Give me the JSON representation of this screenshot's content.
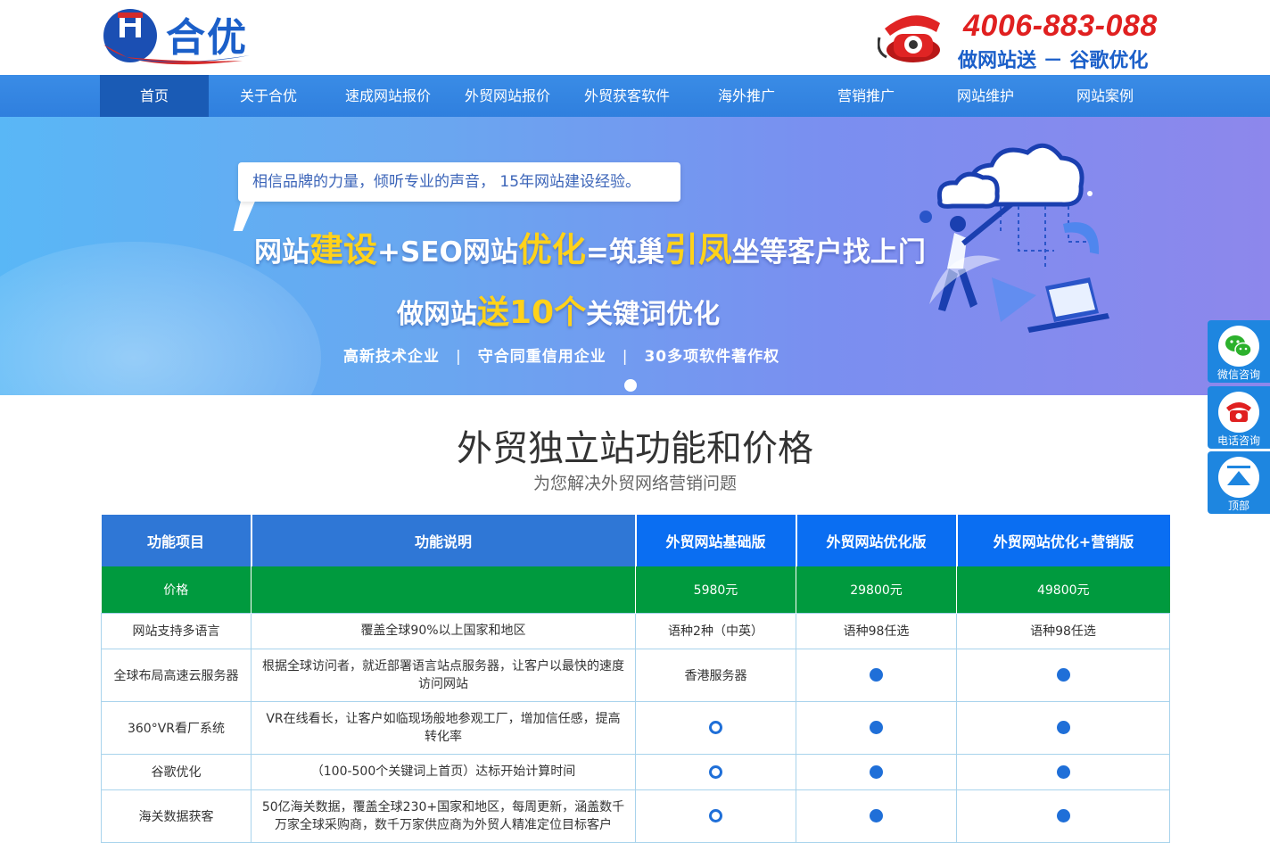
{
  "header": {
    "logo_text": "合优",
    "phone": "4006-883-088",
    "slogan": "做网站送 － 谷歌优化"
  },
  "nav": {
    "items": [
      {
        "label": "首页",
        "active": true
      },
      {
        "label": "关于合优"
      },
      {
        "label": "速成网站报价"
      },
      {
        "label": "外贸网站报价"
      },
      {
        "label": "外贸获客软件"
      },
      {
        "label": "海外推广"
      },
      {
        "label": "营销推广"
      },
      {
        "label": "网站维护"
      },
      {
        "label": "网站案例"
      }
    ]
  },
  "banner": {
    "bubble": "相信品牌的力量，倾听专业的声音， 15年网站建设经验。",
    "headline": [
      "网站",
      "建设",
      "+SEO网站",
      "优化",
      "=筑巢",
      "引凤",
      "坐等客户找上门"
    ],
    "subline": [
      "做网站",
      "送10个",
      "关键词优化"
    ],
    "tags": [
      "高新技术企业",
      "守合同重信用企业",
      "30多项软件著作权"
    ]
  },
  "section": {
    "title": "外贸独立站功能和价格",
    "subtitle": "为您解决外贸网络营销问题"
  },
  "table": {
    "headers": [
      "功能项目",
      "功能说明",
      "外贸网站基础版",
      "外贸网站优化版",
      "外贸网站优化+营销版"
    ],
    "price_row": {
      "label": "价格",
      "desc": "",
      "values": [
        "5980元",
        "29800元",
        "49800元"
      ]
    },
    "rows": [
      {
        "feature": "网站支持多语言",
        "desc": "覆盖全球90%以上国家和地区",
        "cells": [
          "语种2种（中英）",
          "语种98任选",
          "语种98任选"
        ]
      },
      {
        "feature": "全球布局高速云服务器",
        "desc": "根据全球访问者，就近部署语言站点服务器，让客户以最快的速度访问网站",
        "cells": [
          "香港服务器",
          "filled",
          "filled"
        ]
      },
      {
        "feature": "360°VR看厂系统",
        "desc": "VR在线看长，让客户如临现场般地参观工厂，增加信任感，提高转化率",
        "cells": [
          "ring",
          "filled",
          "filled"
        ]
      },
      {
        "feature": "谷歌优化",
        "desc": "（100-500个关键词上首页）达标开始计算时间",
        "cells": [
          "ring",
          "filled",
          "filled"
        ]
      },
      {
        "feature": "海关数据获客",
        "desc": "50亿海关数据，覆盖全球230+国家和地区，每周更新，涵盖数千万家全球采购商，数千万家供应商为外贸人精准定位目标客户",
        "cells": [
          "ring",
          "filled",
          "filled"
        ]
      }
    ]
  },
  "sidebar": {
    "wechat": "微信咨询",
    "phone": "电话咨询",
    "top": "顶部"
  },
  "colors": {
    "brand_blue": "#1b5fc9",
    "nav_blue": "#3a8ce6",
    "price_green": "#009a3e",
    "phone_red": "#e02020",
    "accent_yellow": "#ffd21a"
  }
}
